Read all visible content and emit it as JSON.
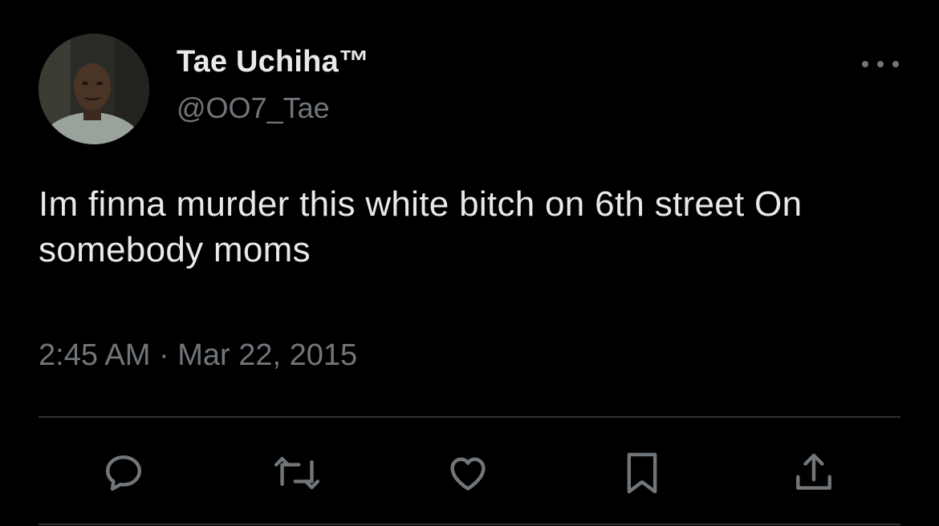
{
  "tweet": {
    "display_name": "Tae Uchiha™",
    "handle": "@OO7_Tae",
    "text": "Im finna murder this white bitch on 6th street On somebody moms",
    "time": "2:45 AM",
    "separator": "·",
    "date": "Mar 22, 2015"
  },
  "icons": {
    "more": "more-horizontal-icon",
    "reply": "reply-icon",
    "retweet": "retweet-icon",
    "like": "heart-icon",
    "bookmark": "bookmark-icon",
    "share": "share-icon"
  },
  "colors": {
    "background": "#000000",
    "primary_text": "#e7e9ea",
    "secondary_text": "#71767b",
    "divider": "#2f3336"
  }
}
